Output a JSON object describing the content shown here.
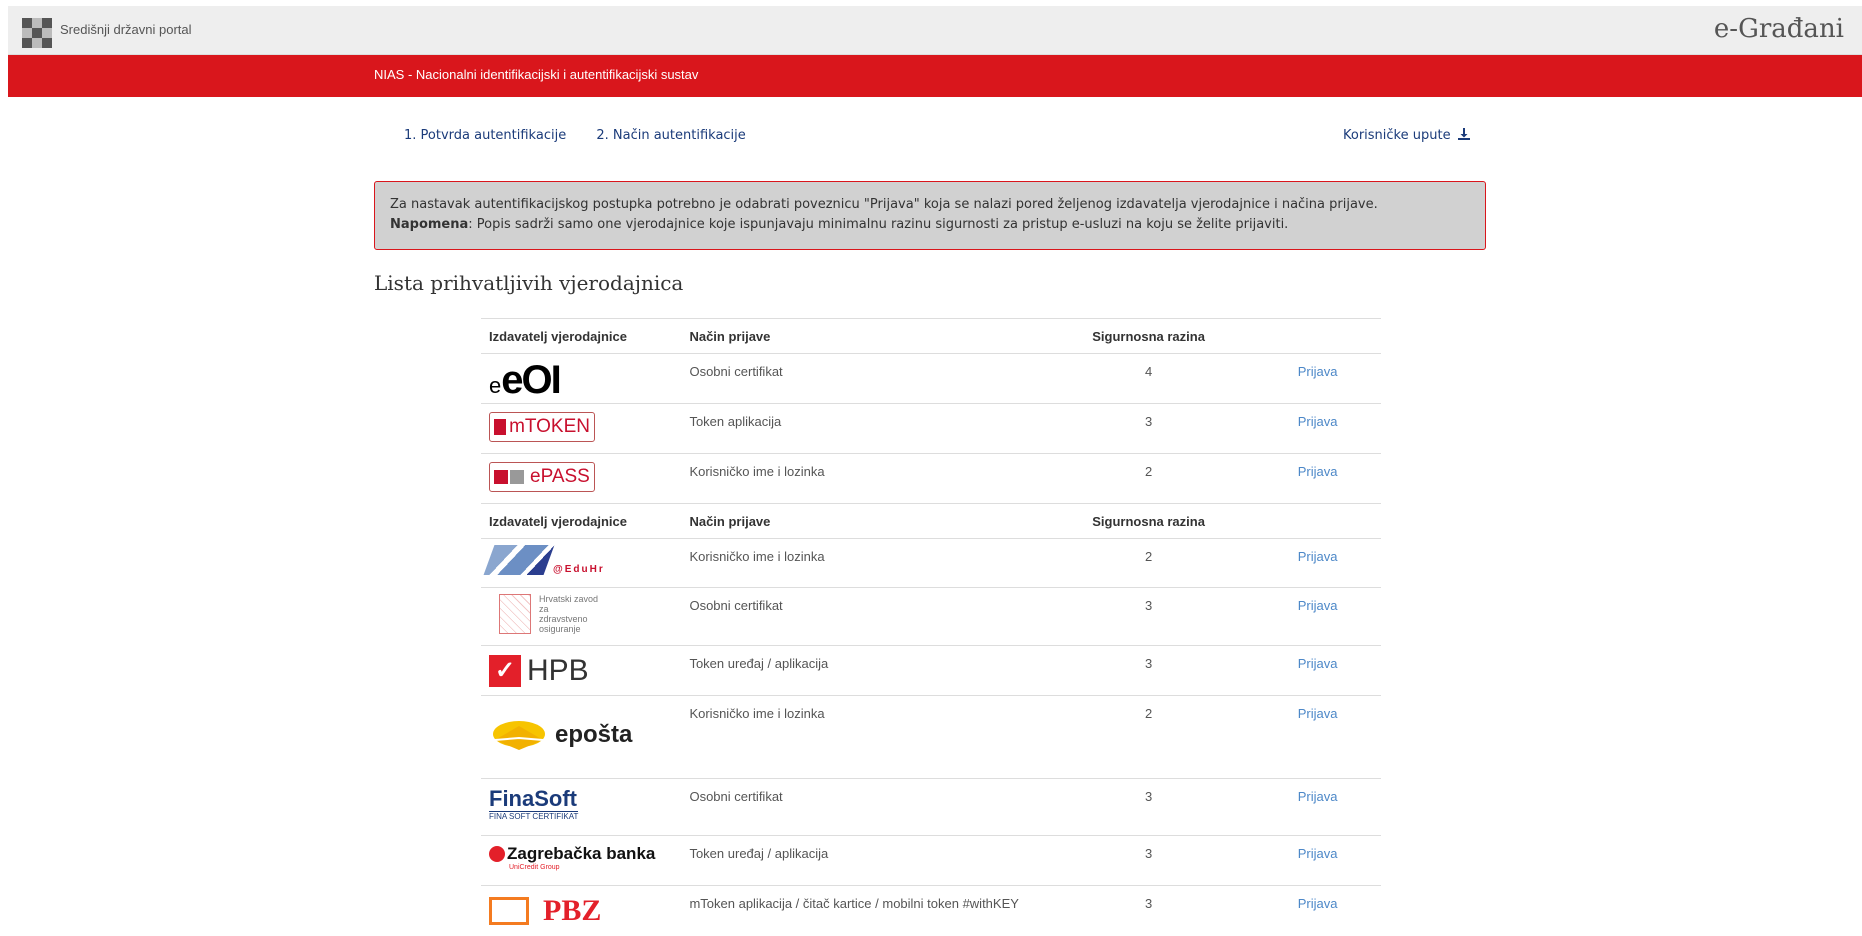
{
  "header": {
    "portal_name": "Središnji državni portal",
    "brand": "e-Građani"
  },
  "banner": {
    "title": "NIAS - Nacionalni identifikacijski i autentifikacijski sustav"
  },
  "steps": [
    "1. Potvrda autentifikacije",
    "2. Način autentifikacije"
  ],
  "guide_link": "Korisničke upute",
  "notice": {
    "line1": "Za nastavak autentifikacijskog postupka potrebno je odabrati poveznicu \"Prijava\" koja se nalazi pored željenog izdavatelja vjerodajnice i načina prijave.",
    "line2_label": "Napomena",
    "line2_text": ": Popis sadrži samo one vjerodajnice koje ispunjavaju minimalnu razinu sigurnosti za pristup e-usluzi na koju se želite prijaviti."
  },
  "list_title": "Lista prihvatljivih vjerodajnica",
  "table": {
    "headers": [
      "Izdavatelj vjerodajnice",
      "Način prijave",
      "Sigurnosna razina"
    ],
    "action_label": "Prijava",
    "group1": [
      {
        "logo": "eOI",
        "method": "Osobni certifikat",
        "level": "4"
      },
      {
        "logo": "mTOKEN",
        "method": "Token aplikacija",
        "level": "3"
      },
      {
        "logo": "ePASS",
        "method": "Korisničko ime i lozinka",
        "level": "2"
      }
    ],
    "group2": [
      {
        "logo": "@EduHr",
        "method": "Korisničko ime i lozinka",
        "level": "2"
      },
      {
        "logo": "Hrvatski zavod za zdravstveno osiguranje",
        "method": "Osobni certifikat",
        "level": "3"
      },
      {
        "logo": "HPB",
        "method": "Token uređaj / aplikacija",
        "level": "3"
      },
      {
        "logo": "epošta",
        "method": "Korisničko ime i lozinka",
        "level": "2"
      },
      {
        "logo": "FinaSoft",
        "logo_sub": "FINA SOFT CERTIFIKAT",
        "method": "Osobni certifikat",
        "level": "3"
      },
      {
        "logo": "Zagrebačka banka",
        "logo_sub": "UniCredit Group",
        "method": "Token uređaj / aplikacija",
        "level": "3"
      },
      {
        "logo": "PBZ",
        "method": "mToken aplikacija / čitač kartice / mobilni token #withKEY",
        "level": "3"
      }
    ]
  },
  "colors": {
    "red": "#d9161c",
    "link": "#4d88c8",
    "nav": "#1b3b7a"
  }
}
